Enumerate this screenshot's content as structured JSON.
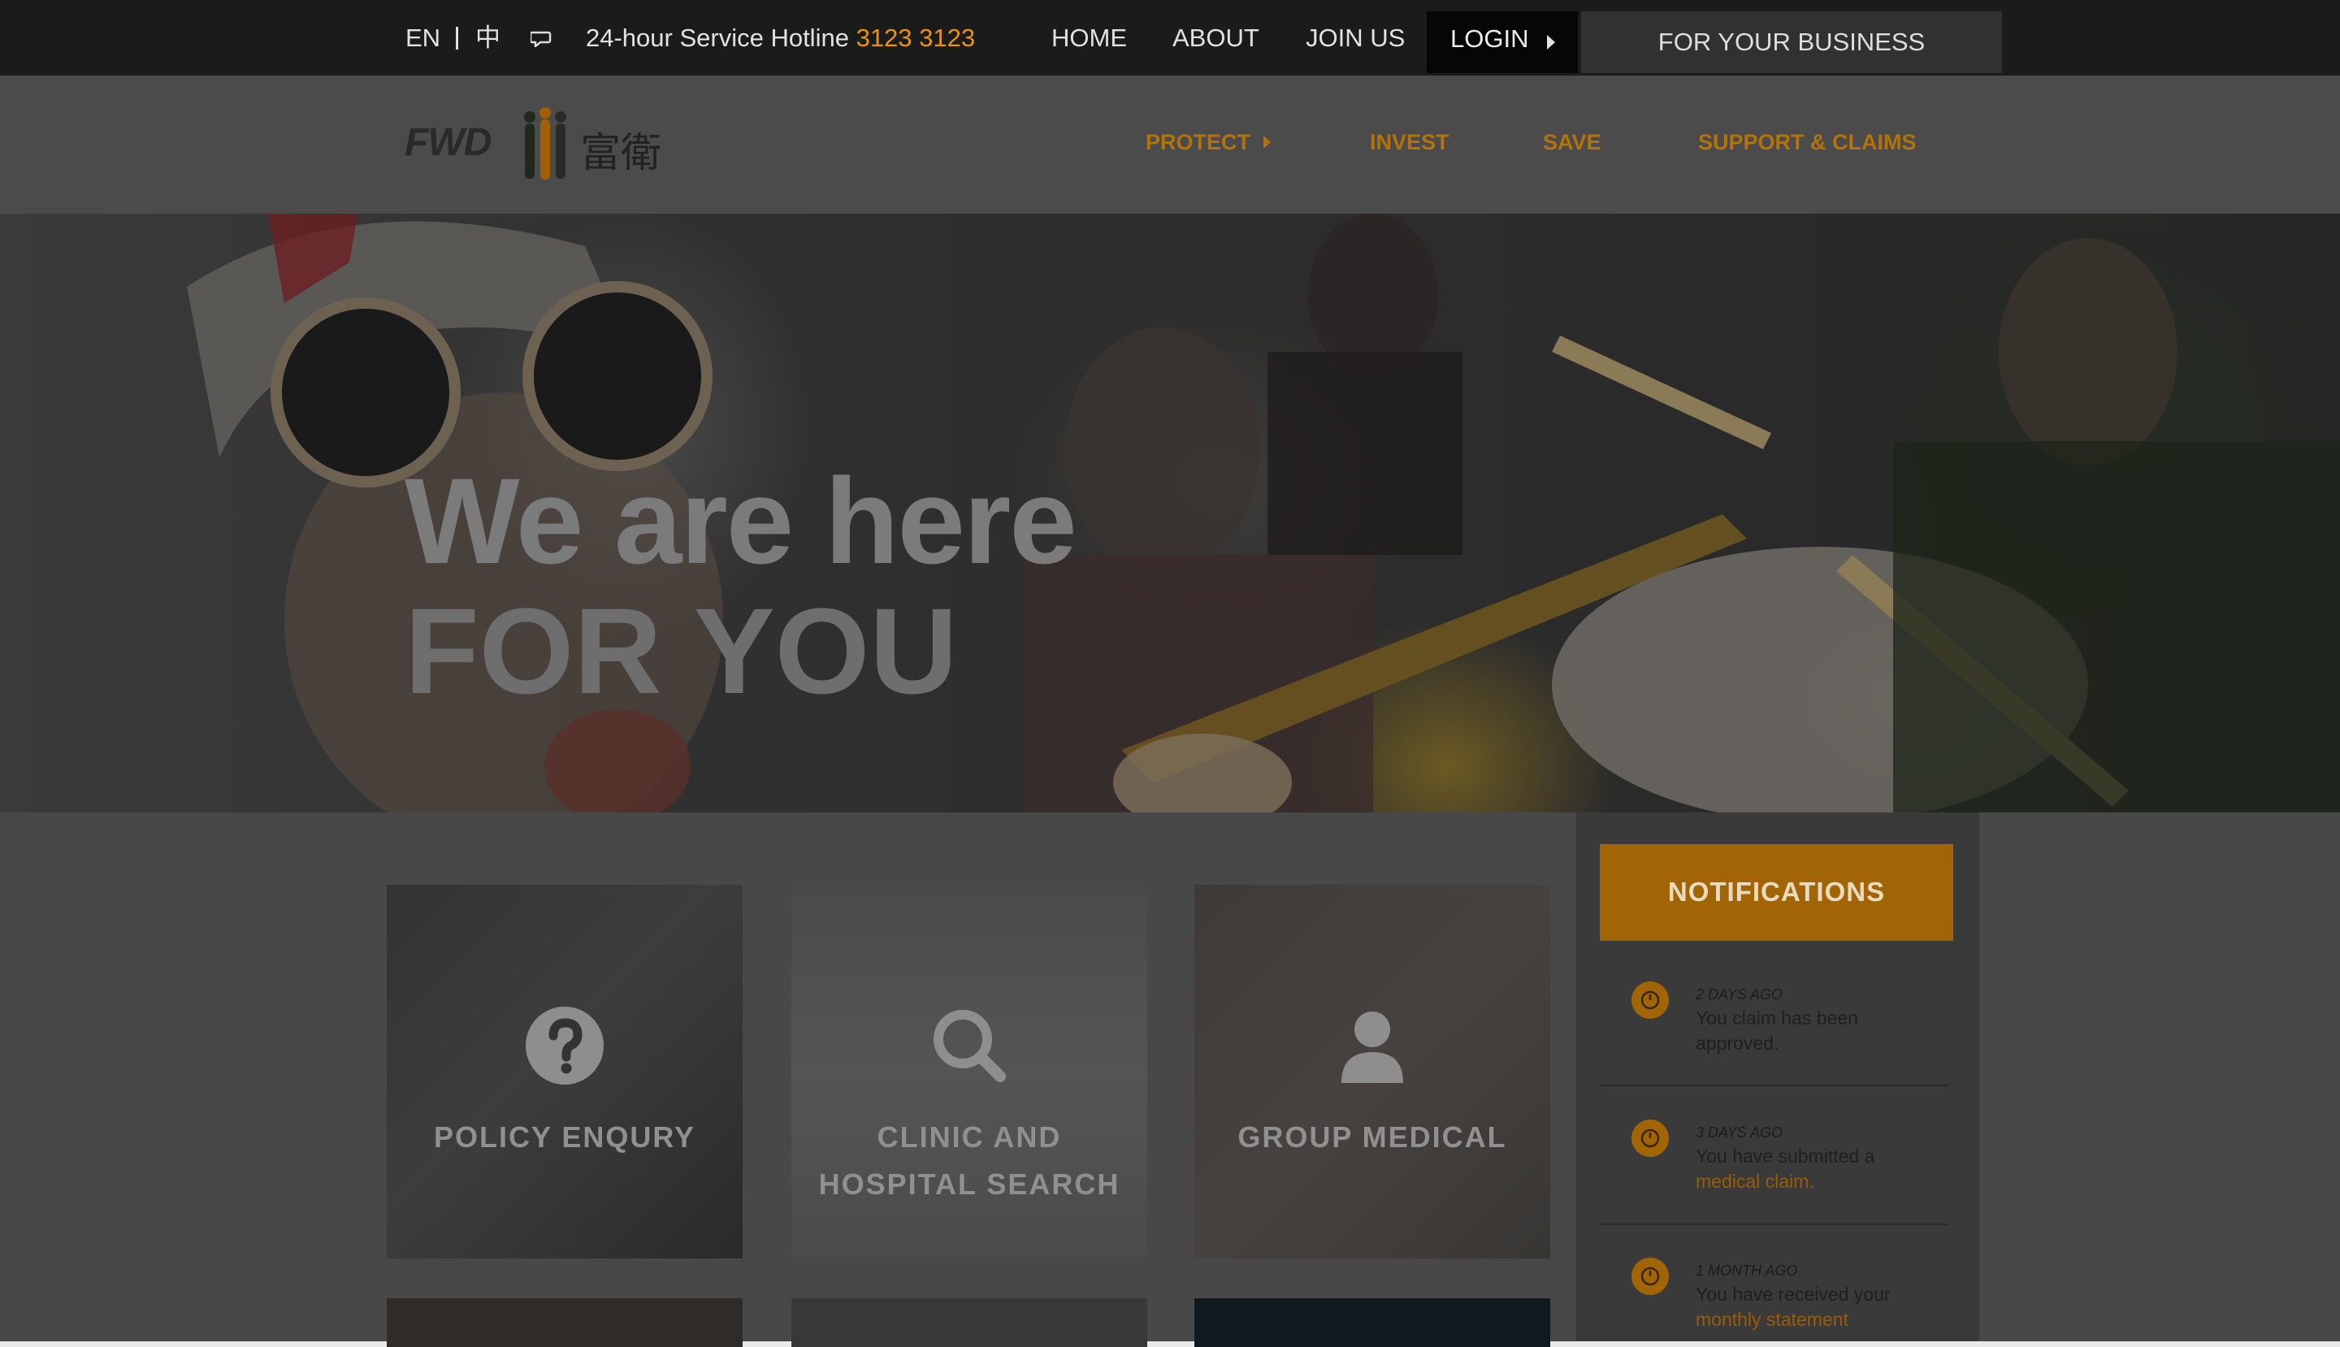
{
  "topbar": {
    "lang_en": "EN",
    "lang_zh": "中",
    "chat_icon": "chat-bubble-icon",
    "hotline_label": "24-hour Service Hotline",
    "hotline_number": "3123 3123",
    "nav": [
      "HOME",
      "ABOUT",
      "JOIN US"
    ],
    "login_label": "LOGIN",
    "business_label": "FOR YOUR BUSINESS"
  },
  "header": {
    "logo_text": "FWD",
    "logo_cn": "富衛",
    "nav": [
      "PROTECT",
      "INVEST",
      "SAVE",
      "SUPPORT & CLAIMS"
    ]
  },
  "hero": {
    "line1": "We are here",
    "line2": "FOR YOU"
  },
  "tiles": [
    {
      "label": "POLICY ENQURY",
      "icon": "question-circle-icon"
    },
    {
      "label_line1": "CLINIC AND",
      "label_line2": "HOSPITAL SEARCH",
      "icon": "magnifier-icon"
    },
    {
      "label": "GROUP MEDICAL",
      "icon": "person-icon"
    }
  ],
  "notifications": {
    "title": "NOTIFICATIONS",
    "items": [
      {
        "time": "2 DAYS AGO",
        "line1": "You claim has been",
        "line2": "approved.",
        "icon": "clock-icon"
      },
      {
        "time": "3 DAYS AGO",
        "line1": "You have submitted a",
        "link": "medical claim.",
        "icon": "clock-icon"
      },
      {
        "time": "1 MONTH AGO",
        "line1": "You have received your",
        "link": "monthly statement",
        "icon": "clock-icon"
      }
    ]
  },
  "colors": {
    "accent": "#e8940d",
    "accent_dim": "#b3720a",
    "topbar_bg": "#1b1b1b",
    "overlay_page": "#4b4b4b"
  }
}
